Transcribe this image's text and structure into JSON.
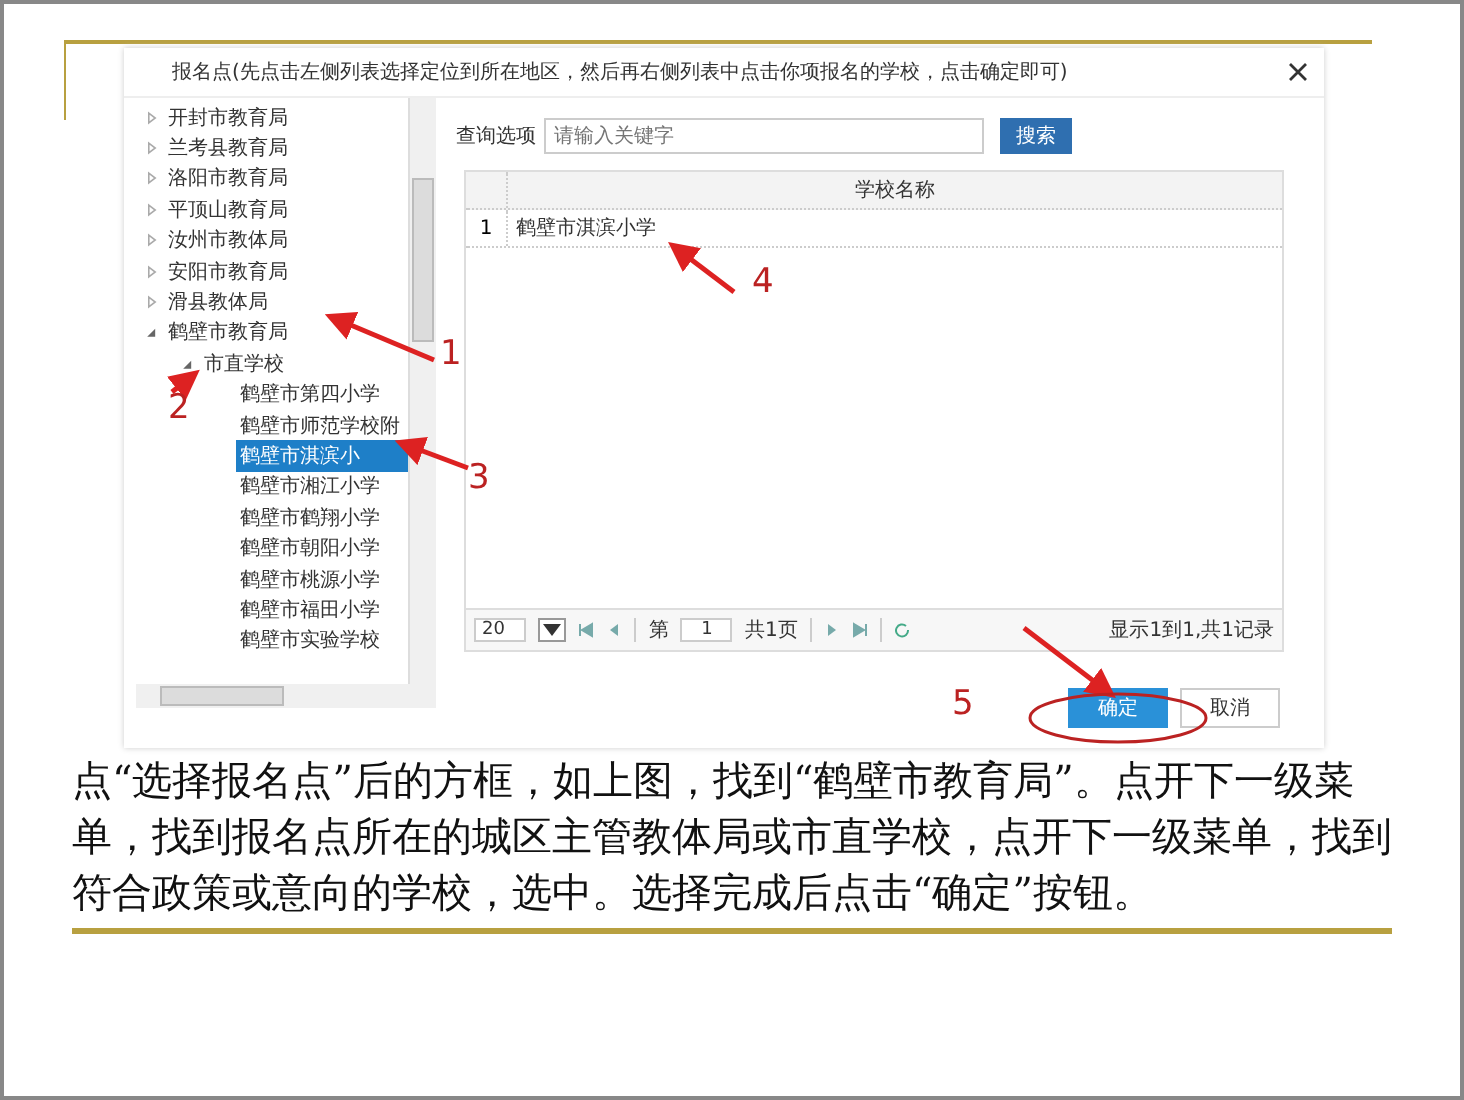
{
  "dialog": {
    "title": "报名点(先点击左侧列表选择定位到所在地区，然后再右侧列表中点击你项报名的学校，点击确定即可)",
    "tree": [
      {
        "label": "开封市教育局",
        "expanded": false,
        "selected": false
      },
      {
        "label": "兰考县教育局",
        "expanded": false,
        "selected": false
      },
      {
        "label": "洛阳市教育局",
        "expanded": false,
        "selected": false
      },
      {
        "label": "平顶山教育局",
        "expanded": false,
        "selected": false
      },
      {
        "label": "汝州市教体局",
        "expanded": false,
        "selected": false
      },
      {
        "label": "安阳市教育局",
        "expanded": false,
        "selected": false
      },
      {
        "label": "滑县教体局",
        "expanded": false,
        "selected": false
      },
      {
        "label": "鹤壁市教育局",
        "expanded": true,
        "selected": false,
        "children": [
          {
            "label": "市直学校",
            "expanded": true,
            "selected": false,
            "children": [
              {
                "label": "鹤壁市第四小学",
                "selected": false
              },
              {
                "label": "鹤壁市师范学校附",
                "selected": false
              },
              {
                "label": "鹤壁市淇滨小",
                "selected": true
              },
              {
                "label": "鹤壁市湘江小学",
                "selected": false
              },
              {
                "label": "鹤壁市鹤翔小学",
                "selected": false
              },
              {
                "label": "鹤壁市朝阳小学",
                "selected": false
              },
              {
                "label": "鹤壁市桃源小学",
                "selected": false
              },
              {
                "label": "鹤壁市福田小学",
                "selected": false
              },
              {
                "label": "鹤壁市实验学校",
                "selected": false
              }
            ]
          }
        ]
      }
    ],
    "search": {
      "label": "查询选项",
      "placeholder": "请输入关键字",
      "button": "搜索"
    },
    "table": {
      "columns": [
        "学校名称"
      ],
      "rows": [
        {
          "index": "1",
          "name": "鹤壁市淇滨小学"
        }
      ]
    },
    "pager": {
      "page_size": "20",
      "page_prefix": "第",
      "page": "1",
      "page_total": "共1页",
      "summary": "显示1到1,共1记录"
    },
    "buttons": [
      {
        "label": "确定",
        "kind": "primary"
      },
      {
        "label": "取消",
        "kind": "default"
      }
    ]
  },
  "annotations": [
    "1",
    "2",
    "3",
    "4",
    "5"
  ],
  "caption": "点“选择报名点”后的方框，如上图，找到“鹤壁市教育局”。点开下一级菜单，找到报名点所在的城区主管教体局或市直学校，点开下一级菜单，找到符合政策或意向的学校，选中。选择完成后点击“确定”按钮。"
}
